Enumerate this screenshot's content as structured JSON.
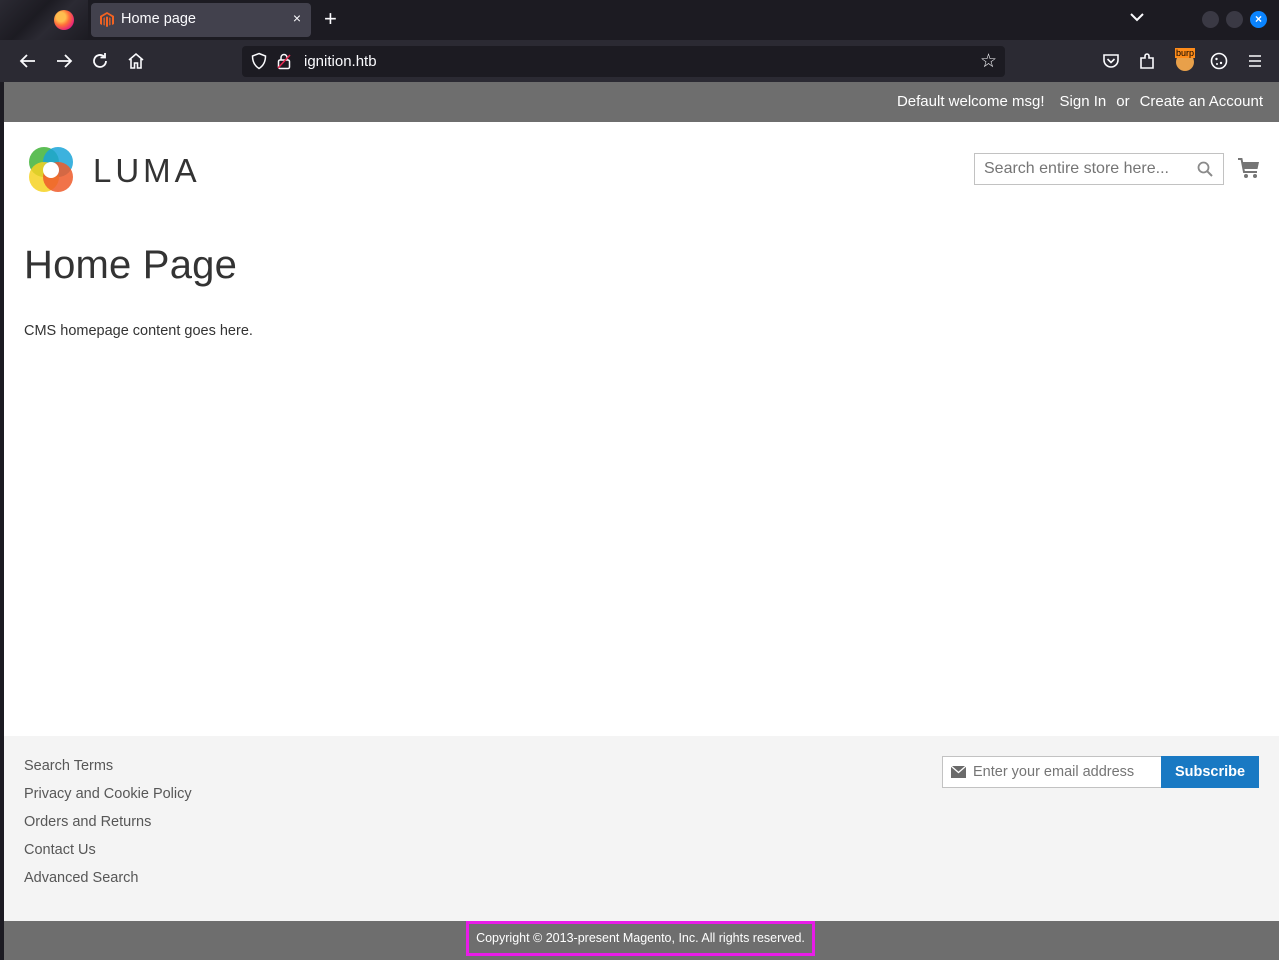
{
  "browser": {
    "tab_title": "Home page",
    "tab_close": "×",
    "new_tab": "+",
    "url": "ignition.htb",
    "window_close": "×",
    "extension_badge": "burp"
  },
  "store": {
    "welcome": "Default welcome msg!",
    "sign_in": "Sign In",
    "or": "or",
    "create_account": "Create an Account",
    "logo_text": "LUMA",
    "search_placeholder": "Search entire store here..."
  },
  "main": {
    "title": "Home Page",
    "content": "CMS homepage content goes here."
  },
  "footer": {
    "links": [
      "Search Terms",
      "Privacy and Cookie Policy",
      "Orders and Returns",
      "Contact Us",
      "Advanced Search"
    ],
    "newsletter_placeholder": "Enter your email address",
    "subscribe": "Subscribe",
    "copyright": "Copyright © 2013-present Magento, Inc. All rights reserved."
  },
  "colors": {
    "accent": "#1979c3",
    "panel": "#6e6e6e",
    "highlight": "#e81ce8"
  }
}
